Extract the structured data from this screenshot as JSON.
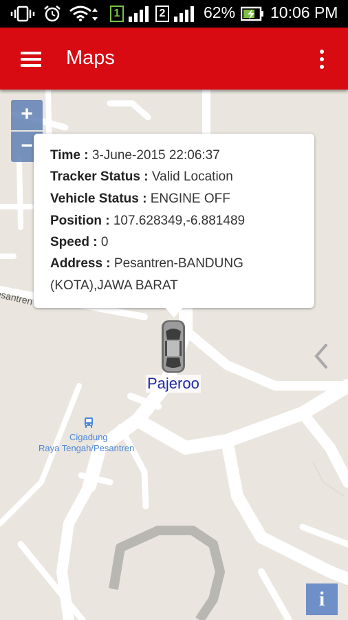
{
  "status_bar": {
    "battery_percent": "62%",
    "time": "10:06 PM",
    "sim1_label": "1",
    "sim2_label": "2",
    "icons": [
      "vibrate-icon",
      "alarm-icon",
      "wifi-icon",
      "sim1-signal-icon",
      "sim2-signal-icon",
      "battery-charging-icon"
    ]
  },
  "app_bar": {
    "title": "Maps",
    "menu_icon": "hamburger-menu-icon",
    "overflow_icon": "overflow-menu-icon",
    "color": "#d80a12"
  },
  "map": {
    "zoom_in_label": "+",
    "zoom_out_label": "−",
    "street_label": "esantren",
    "poi": {
      "line1": "Cigadung",
      "line2": "Raya Tengah/Pesantren",
      "icon": "bus-stop-icon"
    },
    "info_label": "i"
  },
  "popup": {
    "time_label": "Time :",
    "time_value": "3-June-2015 22:06:37",
    "tracker_label": "Tracker Status :",
    "tracker_value": "Valid Location",
    "vehicle_label": "Vehicle Status :",
    "vehicle_value": "ENGINE OFF",
    "position_label": "Position :",
    "position_value": "107.628349,-6.881489",
    "speed_label": "Speed :",
    "speed_value": "0",
    "address_label": "Address :",
    "address_value_line1": "Pesantren-BANDUNG",
    "address_value_line2": "(KOTA),JAWA BARAT"
  },
  "marker": {
    "label": "Pajeroo",
    "icon": "car-icon"
  }
}
